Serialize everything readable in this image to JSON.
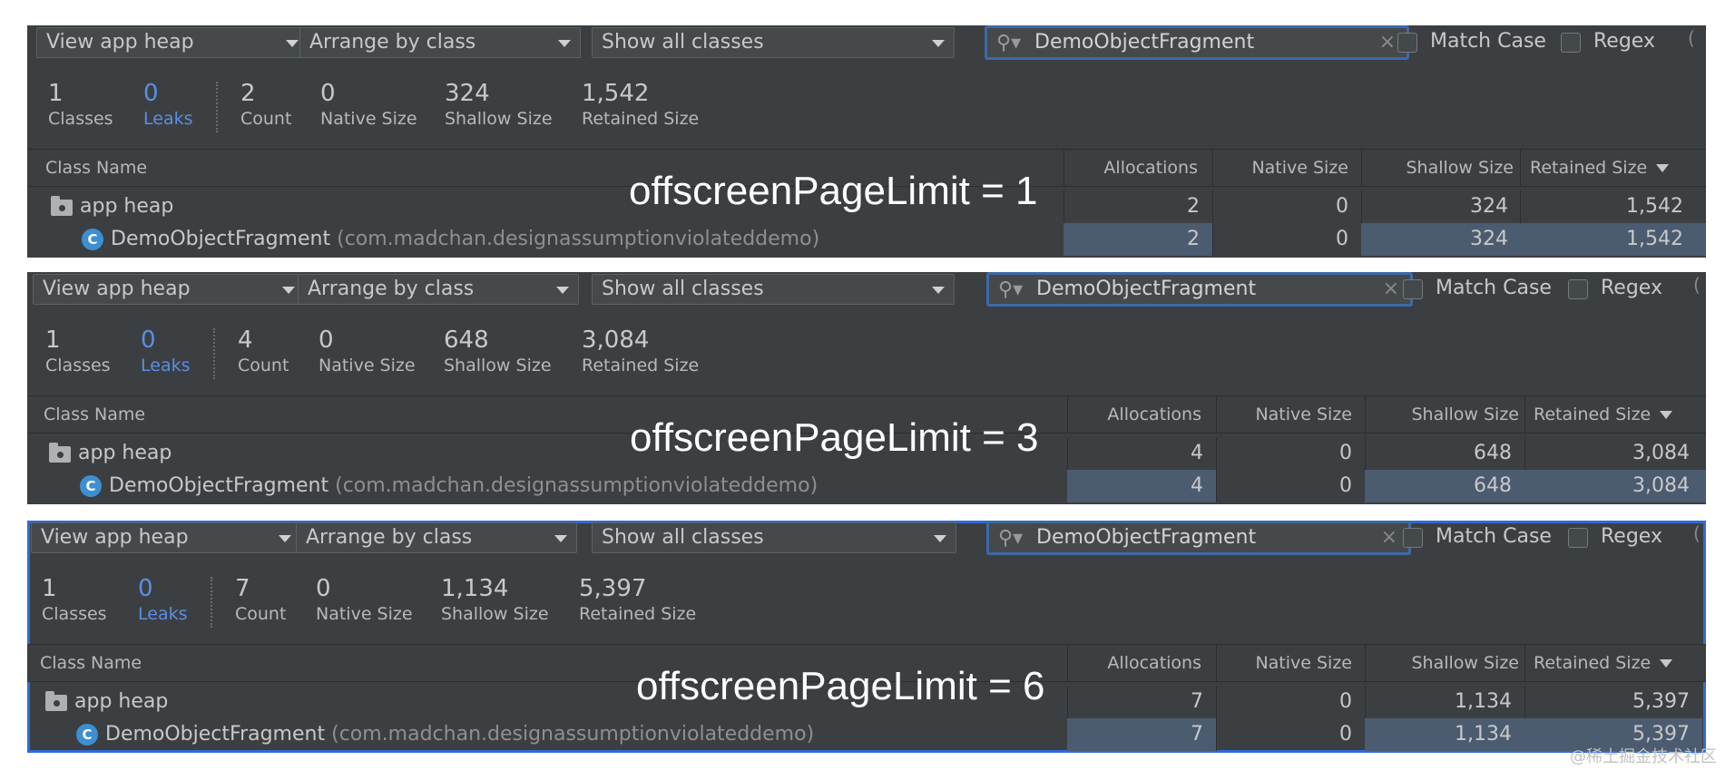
{
  "panels": [
    {
      "toolbar": {
        "heap_select": "View app heap",
        "arrange_select": "Arrange by class",
        "filter_select": "Show all classes",
        "search_value": "DemoObjectFragment",
        "match_case_label": "Match Case",
        "regex_label": "Regex"
      },
      "stats": {
        "classes": "1",
        "classes_label": "Classes",
        "leaks": "0",
        "leaks_label": "Leaks",
        "count": "2",
        "count_label": "Count",
        "native": "0",
        "native_label": "Native Size",
        "shallow": "324",
        "shallow_label": "Shallow Size",
        "retained": "1,542",
        "retained_label": "Retained Size"
      },
      "columns": {
        "class_name": "Class Name",
        "allocations": "Allocations",
        "native": "Native Size",
        "shallow": "Shallow Size",
        "retained": "Retained Size"
      },
      "overlay": "offscreenPageLimit = 1",
      "rows": [
        {
          "name": "app heap",
          "pkg": "",
          "allocations": "2",
          "native": "0",
          "shallow": "324",
          "retained": "1,542"
        },
        {
          "name": "DemoObjectFragment",
          "pkg": "(com.madchan.designassumptionviolateddemo)",
          "allocations": "2",
          "native": "0",
          "shallow": "324",
          "retained": "1,542"
        }
      ]
    },
    {
      "toolbar": {
        "heap_select": "View app heap",
        "arrange_select": "Arrange by class",
        "filter_select": "Show all classes",
        "search_value": "DemoObjectFragment",
        "match_case_label": "Match Case",
        "regex_label": "Regex"
      },
      "stats": {
        "classes": "1",
        "classes_label": "Classes",
        "leaks": "0",
        "leaks_label": "Leaks",
        "count": "4",
        "count_label": "Count",
        "native": "0",
        "native_label": "Native Size",
        "shallow": "648",
        "shallow_label": "Shallow Size",
        "retained": "3,084",
        "retained_label": "Retained Size"
      },
      "columns": {
        "class_name": "Class Name",
        "allocations": "Allocations",
        "native": "Native Size",
        "shallow": "Shallow Size",
        "retained": "Retained Size"
      },
      "overlay": "offscreenPageLimit = 3",
      "rows": [
        {
          "name": "app heap",
          "pkg": "",
          "allocations": "4",
          "native": "0",
          "shallow": "648",
          "retained": "3,084"
        },
        {
          "name": "DemoObjectFragment",
          "pkg": "(com.madchan.designassumptionviolateddemo)",
          "allocations": "4",
          "native": "0",
          "shallow": "648",
          "retained": "3,084"
        }
      ]
    },
    {
      "toolbar": {
        "heap_select": "View app heap",
        "arrange_select": "Arrange by class",
        "filter_select": "Show all classes",
        "search_value": "DemoObjectFragment",
        "match_case_label": "Match Case",
        "regex_label": "Regex"
      },
      "stats": {
        "classes": "1",
        "classes_label": "Classes",
        "leaks": "0",
        "leaks_label": "Leaks",
        "count": "7",
        "count_label": "Count",
        "native": "0",
        "native_label": "Native Size",
        "shallow": "1,134",
        "shallow_label": "Shallow Size",
        "retained": "5,397",
        "retained_label": "Retained Size"
      },
      "columns": {
        "class_name": "Class Name",
        "allocations": "Allocations",
        "native": "Native Size",
        "shallow": "Shallow Size",
        "retained": "Retained Size"
      },
      "overlay": "offscreenPageLimit = 6",
      "rows": [
        {
          "name": "app heap",
          "pkg": "",
          "allocations": "7",
          "native": "0",
          "shallow": "1,134",
          "retained": "5,397"
        },
        {
          "name": "DemoObjectFragment",
          "pkg": "(com.madchan.designassumptionviolateddemo)",
          "allocations": "7",
          "native": "0",
          "shallow": "1,134",
          "retained": "5,397"
        }
      ]
    }
  ],
  "icons": {
    "search": "search-icon",
    "clear": "clear-icon",
    "folder": "folder-icon",
    "class": "class-icon",
    "class_letter": "C"
  },
  "colors": {
    "panel_bg": "#3c3f41",
    "leaks_accent": "#5a8ee5",
    "selection_border": "#2f6bd8",
    "row_highlight": "#4b5b70"
  },
  "watermark": "@稀土掘金技术社区"
}
